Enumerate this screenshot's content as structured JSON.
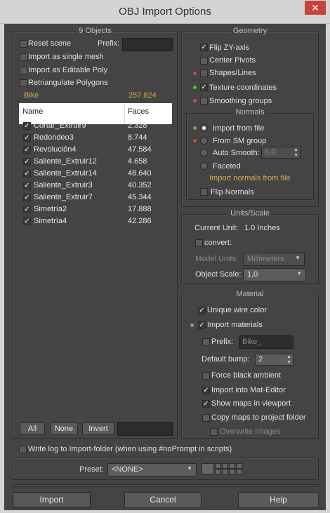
{
  "window": {
    "title": "OBJ Import Options",
    "close_glyph": "✕"
  },
  "objects": {
    "title": "9 Objects",
    "reset_scene": "Reset scene",
    "prefix_label": "Prefix:",
    "prefix_value": "",
    "single_mesh": "Import as single mesh",
    "editable_poly": "Import as Editable Poly",
    "retriangulate": "Retriangulate Polygons",
    "file_name": "Bike",
    "file_faces": "257.824",
    "col_name": "Name",
    "col_faces": "Faces",
    "rows": [
      {
        "name": "Cortar_Extruir9",
        "faces": "2.328"
      },
      {
        "name": "Redondeo3",
        "faces": "8.744"
      },
      {
        "name": "Revolución4",
        "faces": "47.584"
      },
      {
        "name": "Saliente_Extruir12",
        "faces": "4.658"
      },
      {
        "name": "Saliente_Extruir14",
        "faces": "48.640"
      },
      {
        "name": "Saliente_Extruir3",
        "faces": "40.352"
      },
      {
        "name": "Saliente_Extruir7",
        "faces": "45.344"
      },
      {
        "name": "Simetría2",
        "faces": "17.888"
      },
      {
        "name": "Simetría4",
        "faces": "42.286"
      }
    ],
    "btn_all": "All",
    "btn_none": "None",
    "btn_invert": "Invert",
    "filter_value": ""
  },
  "geometry": {
    "title": "Geometry",
    "flip_zy": "Flip ZY-axis",
    "center_pivots": "Center Pivots",
    "shapes_lines": "Shapes/Lines",
    "texture_coords": "Texture coordinates",
    "smoothing_groups": "Smoothing groups"
  },
  "normals": {
    "title": "Normals",
    "from_file": "Import from file",
    "from_sm": "From SM group",
    "auto_smooth": "Auto Smooth:",
    "auto_smooth_value": "0,0",
    "faceted": "Faceted",
    "note": "Import normals from file",
    "flip_normals": "Flip Normals"
  },
  "units": {
    "title": "Units/Scale",
    "current_unit_label": "Current Unit:",
    "current_unit_value": "1.0 Inches",
    "convert": "convert:",
    "model_units_label": "Model Units:",
    "model_units_value": "Millimeters",
    "object_scale_label": "Object Scale:",
    "object_scale_value": "1,0"
  },
  "material": {
    "title": "Material",
    "unique_wire": "Unique wire color",
    "import_materials": "Import materials",
    "prefix_label": "Prefix:",
    "prefix_placeholder": "Bike_",
    "default_bump_label": "Default bump:",
    "default_bump_value": "2",
    "force_black": "Force black ambient",
    "mat_editor": "Import into Mat-Editor",
    "show_maps": "Show maps in viewport",
    "copy_maps": "Copy maps to project folder",
    "overwrite": "Overwrite Images"
  },
  "footer": {
    "write_log": "Write log to Import-folder (when using #noPrompt in scripts)",
    "preset_label": "Preset:",
    "preset_value": "<NONE>",
    "import": "Import",
    "cancel": "Cancel",
    "help": "Help"
  },
  "colors": {
    "background": "#444444",
    "accent_orange": "#d8a94a",
    "dot_red": "#c84a4a",
    "dot_green": "#4ec24e"
  }
}
